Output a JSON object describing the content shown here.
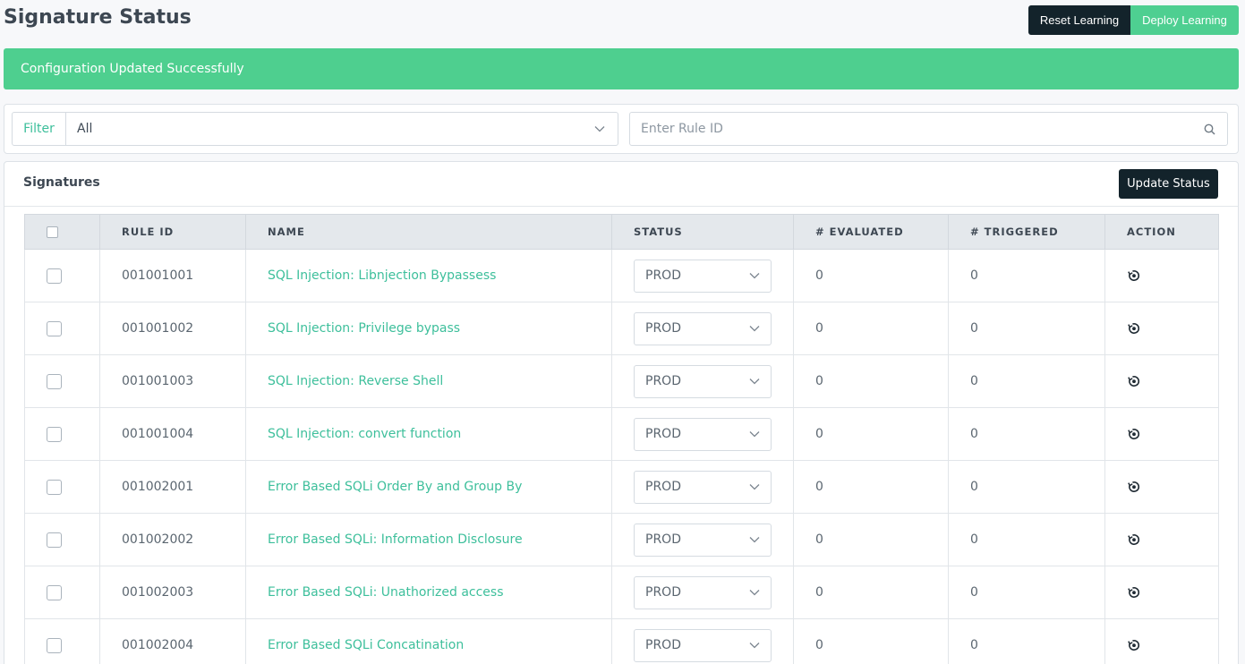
{
  "page": {
    "title": "Signature Status"
  },
  "header_buttons": {
    "reset_label": "Reset Learning",
    "deploy_label": "Deploy Learning"
  },
  "alert": {
    "message": "Configuration Updated Successfully"
  },
  "filter": {
    "label": "Filter",
    "selected": "All",
    "search_placeholder": "Enter Rule ID"
  },
  "signatures": {
    "title": "Signatures",
    "update_label": "Update Status",
    "columns": [
      "RULE ID",
      "NAME",
      "STATUS",
      "# EVALUATED",
      "# TRIGGERED",
      "ACTION"
    ],
    "rows": [
      {
        "rule_id": "001001001",
        "name": "SQL Injection: Libnjection Bypassess",
        "status": "PROD",
        "evaluated": "0",
        "triggered": "0"
      },
      {
        "rule_id": "001001002",
        "name": "SQL Injection: Privilege bypass",
        "status": "PROD",
        "evaluated": "0",
        "triggered": "0"
      },
      {
        "rule_id": "001001003",
        "name": "SQL Injection: Reverse Shell",
        "status": "PROD",
        "evaluated": "0",
        "triggered": "0"
      },
      {
        "rule_id": "001001004",
        "name": "SQL Injection: convert function",
        "status": "PROD",
        "evaluated": "0",
        "triggered": "0"
      },
      {
        "rule_id": "001002001",
        "name": "Error Based SQLi Order By and Group By",
        "status": "PROD",
        "evaluated": "0",
        "triggered": "0"
      },
      {
        "rule_id": "001002002",
        "name": "Error Based SQLi: Information Disclosure",
        "status": "PROD",
        "evaluated": "0",
        "triggered": "0"
      },
      {
        "rule_id": "001002003",
        "name": "Error Based SQLi: Unathorized access",
        "status": "PROD",
        "evaluated": "0",
        "triggered": "0"
      },
      {
        "rule_id": "001002004",
        "name": "Error Based SQLi Concatination",
        "status": "PROD",
        "evaluated": "0",
        "triggered": "0"
      }
    ]
  },
  "icons": {
    "dropdown": "chevron-down-icon",
    "search": "search-icon",
    "action": "reset-icon"
  },
  "colors": {
    "accent_green": "#4ecf91",
    "dark_button": "#13232b",
    "link_teal": "#3dbf9b"
  }
}
